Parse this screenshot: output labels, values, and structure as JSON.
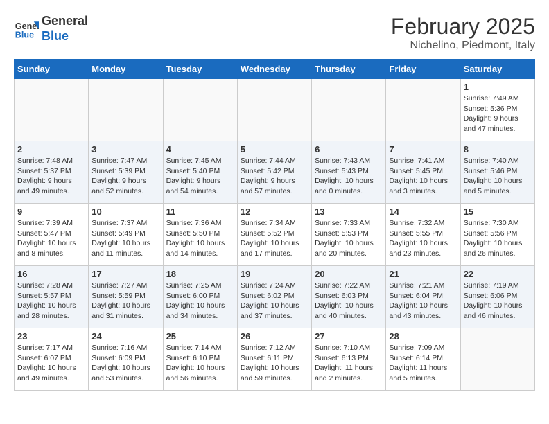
{
  "header": {
    "logo_line1": "General",
    "logo_line2": "Blue",
    "month": "February 2025",
    "location": "Nichelino, Piedmont, Italy"
  },
  "days_of_week": [
    "Sunday",
    "Monday",
    "Tuesday",
    "Wednesday",
    "Thursday",
    "Friday",
    "Saturday"
  ],
  "weeks": [
    [
      {
        "day": "",
        "info": ""
      },
      {
        "day": "",
        "info": ""
      },
      {
        "day": "",
        "info": ""
      },
      {
        "day": "",
        "info": ""
      },
      {
        "day": "",
        "info": ""
      },
      {
        "day": "",
        "info": ""
      },
      {
        "day": "1",
        "info": "Sunrise: 7:49 AM\nSunset: 5:36 PM\nDaylight: 9 hours\nand 47 minutes."
      }
    ],
    [
      {
        "day": "2",
        "info": "Sunrise: 7:48 AM\nSunset: 5:37 PM\nDaylight: 9 hours\nand 49 minutes."
      },
      {
        "day": "3",
        "info": "Sunrise: 7:47 AM\nSunset: 5:39 PM\nDaylight: 9 hours\nand 52 minutes."
      },
      {
        "day": "4",
        "info": "Sunrise: 7:45 AM\nSunset: 5:40 PM\nDaylight: 9 hours\nand 54 minutes."
      },
      {
        "day": "5",
        "info": "Sunrise: 7:44 AM\nSunset: 5:42 PM\nDaylight: 9 hours\nand 57 minutes."
      },
      {
        "day": "6",
        "info": "Sunrise: 7:43 AM\nSunset: 5:43 PM\nDaylight: 10 hours\nand 0 minutes."
      },
      {
        "day": "7",
        "info": "Sunrise: 7:41 AM\nSunset: 5:45 PM\nDaylight: 10 hours\nand 3 minutes."
      },
      {
        "day": "8",
        "info": "Sunrise: 7:40 AM\nSunset: 5:46 PM\nDaylight: 10 hours\nand 5 minutes."
      }
    ],
    [
      {
        "day": "9",
        "info": "Sunrise: 7:39 AM\nSunset: 5:47 PM\nDaylight: 10 hours\nand 8 minutes."
      },
      {
        "day": "10",
        "info": "Sunrise: 7:37 AM\nSunset: 5:49 PM\nDaylight: 10 hours\nand 11 minutes."
      },
      {
        "day": "11",
        "info": "Sunrise: 7:36 AM\nSunset: 5:50 PM\nDaylight: 10 hours\nand 14 minutes."
      },
      {
        "day": "12",
        "info": "Sunrise: 7:34 AM\nSunset: 5:52 PM\nDaylight: 10 hours\nand 17 minutes."
      },
      {
        "day": "13",
        "info": "Sunrise: 7:33 AM\nSunset: 5:53 PM\nDaylight: 10 hours\nand 20 minutes."
      },
      {
        "day": "14",
        "info": "Sunrise: 7:32 AM\nSunset: 5:55 PM\nDaylight: 10 hours\nand 23 minutes."
      },
      {
        "day": "15",
        "info": "Sunrise: 7:30 AM\nSunset: 5:56 PM\nDaylight: 10 hours\nand 26 minutes."
      }
    ],
    [
      {
        "day": "16",
        "info": "Sunrise: 7:28 AM\nSunset: 5:57 PM\nDaylight: 10 hours\nand 28 minutes."
      },
      {
        "day": "17",
        "info": "Sunrise: 7:27 AM\nSunset: 5:59 PM\nDaylight: 10 hours\nand 31 minutes."
      },
      {
        "day": "18",
        "info": "Sunrise: 7:25 AM\nSunset: 6:00 PM\nDaylight: 10 hours\nand 34 minutes."
      },
      {
        "day": "19",
        "info": "Sunrise: 7:24 AM\nSunset: 6:02 PM\nDaylight: 10 hours\nand 37 minutes."
      },
      {
        "day": "20",
        "info": "Sunrise: 7:22 AM\nSunset: 6:03 PM\nDaylight: 10 hours\nand 40 minutes."
      },
      {
        "day": "21",
        "info": "Sunrise: 7:21 AM\nSunset: 6:04 PM\nDaylight: 10 hours\nand 43 minutes."
      },
      {
        "day": "22",
        "info": "Sunrise: 7:19 AM\nSunset: 6:06 PM\nDaylight: 10 hours\nand 46 minutes."
      }
    ],
    [
      {
        "day": "23",
        "info": "Sunrise: 7:17 AM\nSunset: 6:07 PM\nDaylight: 10 hours\nand 49 minutes."
      },
      {
        "day": "24",
        "info": "Sunrise: 7:16 AM\nSunset: 6:09 PM\nDaylight: 10 hours\nand 53 minutes."
      },
      {
        "day": "25",
        "info": "Sunrise: 7:14 AM\nSunset: 6:10 PM\nDaylight: 10 hours\nand 56 minutes."
      },
      {
        "day": "26",
        "info": "Sunrise: 7:12 AM\nSunset: 6:11 PM\nDaylight: 10 hours\nand 59 minutes."
      },
      {
        "day": "27",
        "info": "Sunrise: 7:10 AM\nSunset: 6:13 PM\nDaylight: 11 hours\nand 2 minutes."
      },
      {
        "day": "28",
        "info": "Sunrise: 7:09 AM\nSunset: 6:14 PM\nDaylight: 11 hours\nand 5 minutes."
      },
      {
        "day": "",
        "info": ""
      }
    ]
  ]
}
